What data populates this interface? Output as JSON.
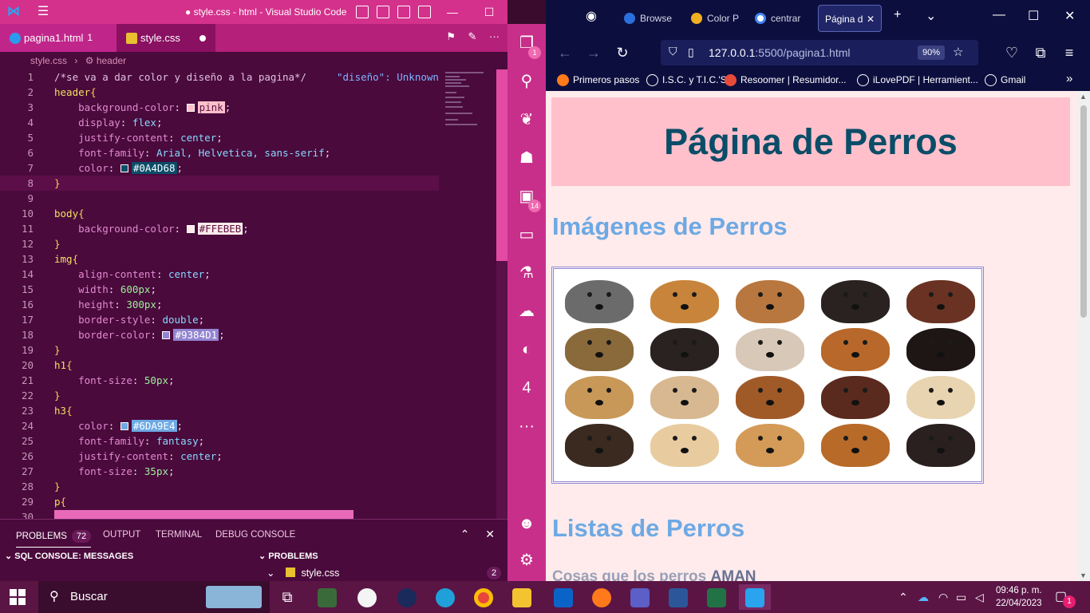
{
  "vscode": {
    "window_title": "● style.css - html - Visual Studio Code",
    "tabs": [
      {
        "label": "pagina1.html",
        "badge": "1"
      },
      {
        "label": "style.css"
      }
    ],
    "breadcrumb": {
      "file": "style.css",
      "symbol": "header"
    },
    "code_lines": [
      "/*se va a dar color y diseño a la pagina*/",
      "header{",
      "    background-color: pink;",
      "    display: flex;",
      "    justify-content: center;",
      "    font-family: Arial, Helvetica, sans-serif;",
      "    color: #0A4D68;",
      "}",
      "",
      "body{",
      "    background-color: #FFEBEB;",
      "}",
      "img{",
      "    align-content: center;",
      "    width: 600px;",
      "    height: 300px;",
      "    border-style: double;",
      "    border-color: #9384D1;",
      "}",
      "h1{",
      "    font-size: 50px;",
      "}",
      "h3{",
      "    color: #6DA9E4;",
      "    font-family: fantasy;",
      "    justify-content: center;",
      "    font-size: 35px;",
      "}",
      "p{",
      ""
    ],
    "inline_warning": "\"diseño\": Unknown",
    "panel": {
      "tabs": [
        "PROBLEMS",
        "OUTPUT",
        "TERMINAL",
        "DEBUG CONSOLE"
      ],
      "problems_count": "72",
      "sql_console_header": "SQL CONSOLE: MESSAGES",
      "problems_header": "PROBLEMS",
      "problem_file": "style.css",
      "problem_file_count": "2"
    },
    "activity_badges": {
      "explorer": "1",
      "extensions": "14"
    }
  },
  "firefox": {
    "tabs": [
      {
        "label": "Browse"
      },
      {
        "label": "Color P"
      },
      {
        "label": "centrar"
      },
      {
        "label": "Página d"
      }
    ],
    "url_host": "127.0.0.1",
    "url_rest": ":5500/pagina1.html",
    "zoom": "90%",
    "bookmarks": [
      "Primeros pasos",
      "I.S.C. y T.I.C.'S",
      "Resoomer | Resumidor...",
      "iLovePDF | Herramient...",
      "Gmail"
    ],
    "page": {
      "h1": "Página de Perros",
      "h3_images": "Imágenes de Perros",
      "h3_lists": "Listas de Perros",
      "list_intro": "Cosas que los perros",
      "list_intro_bold": "AMAN"
    }
  },
  "taskbar": {
    "search_placeholder": "Buscar",
    "time": "09:46 p. m.",
    "date": "22/04/2023",
    "notifications": "1"
  },
  "colors": {
    "header_bg": "pink",
    "h1": "#0A4D68",
    "body_bg": "#FFEBEB",
    "img_border": "#9384D1",
    "h3": "#6DA9E4"
  }
}
